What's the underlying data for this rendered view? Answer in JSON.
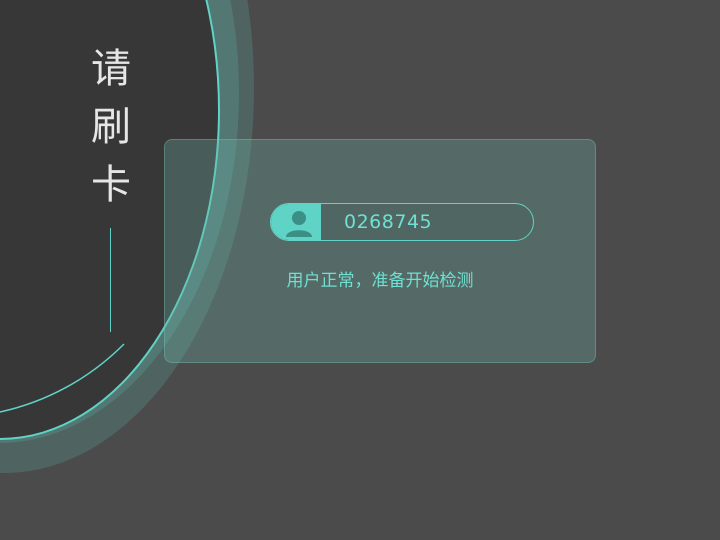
{
  "title_chars": [
    "请",
    "刷",
    "卡"
  ],
  "card": {
    "card_id": "0268745",
    "user_icon": "user-icon",
    "status_text": "用户正常，准备开始检测"
  },
  "colors": {
    "background": "#4b4b4b",
    "disc": "#373737",
    "accent": "#5fd3c5",
    "title_text": "#e6e6e6"
  }
}
